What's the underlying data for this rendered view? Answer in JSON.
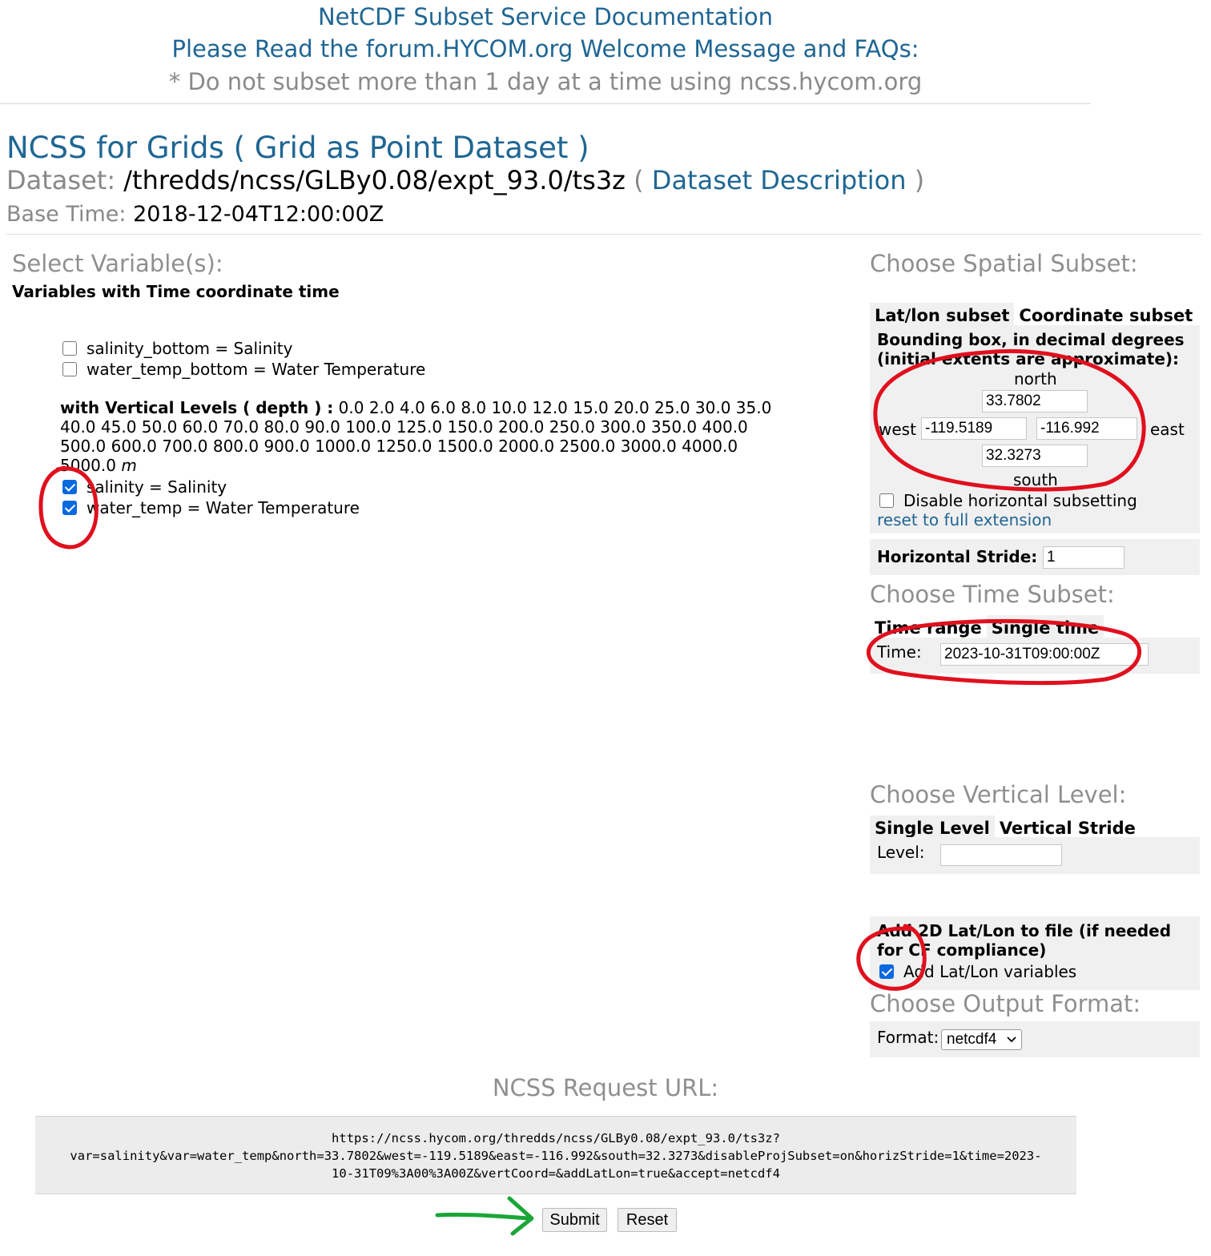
{
  "banner": {
    "doc_link": "NetCDF Subset Service Documentation",
    "forum_link": "Please Read the forum.HYCOM.org Welcome Message and FAQs:",
    "note": "* Do not subset more than 1 day at a time using ncss.hycom.org"
  },
  "header": {
    "title": "NCSS for Grids",
    "title_paren_open": "(",
    "title_link": "Grid as Point Dataset",
    "title_paren_close": ")",
    "dataset_label": "Dataset:",
    "dataset_value": "/thredds/ncss/GLBy0.08/expt_93.0/ts3z",
    "dataset_paren_open": "(",
    "dataset_link": "Dataset Description",
    "dataset_paren_close": ")",
    "base_time_label": "Base Time:",
    "base_time_value": "2018-12-04T12:00:00Z"
  },
  "variables": {
    "heading": "Select Variable(s):",
    "group_title": "Variables with Time coordinate time",
    "time_vars": [
      {
        "label": "salinity_bottom = Salinity",
        "checked": false
      },
      {
        "label": "water_temp_bottom = Water Temperature",
        "checked": false
      }
    ],
    "vertical_title": "with Vertical Levels ( depth ) :",
    "vertical_levels": "0.0 2.0 4.0 6.0 8.0 10.0 12.0 15.0 20.0 25.0 30.0 35.0 40.0 45.0 50.0 60.0 70.0 80.0 90.0 100.0 125.0 150.0 200.0 250.0 300.0 350.0 400.0 500.0 600.0 700.0 800.0 900.0 1000.0 1250.0 1500.0 2000.0 2500.0 3000.0 4000.0 5000.0",
    "vertical_unit": "m",
    "depth_vars": [
      {
        "label": "salinity = Salinity",
        "checked": true
      },
      {
        "label": "water_temp = Water Temperature",
        "checked": true
      }
    ]
  },
  "spatial": {
    "heading": "Choose Spatial Subset:",
    "tab_latlon": "Lat/lon subset",
    "tab_coord": "Coordinate subset",
    "bbox_title_line1": "Bounding box, in decimal degrees",
    "bbox_title_line2": "(initial extents are approximate):",
    "north_label": "north",
    "north": "33.7802",
    "west_label": "west",
    "west": "-119.5189",
    "east": "-116.992",
    "east_label": "east",
    "south": "32.3273",
    "south_label": "south",
    "disable_label": "Disable horizontal subsetting",
    "disable_checked": false,
    "reset_link": "reset to full extension",
    "stride_label": "Horizontal Stride:",
    "stride": "1"
  },
  "time": {
    "heading": "Choose Time Subset:",
    "tab_range": "Time range",
    "tab_single": "Single time",
    "time_label": "Time:",
    "time_value": "2023-10-31T09:00:00Z"
  },
  "vertical": {
    "heading": "Choose Vertical Level:",
    "tab_single": "Single Level",
    "tab_stride": "Vertical Stride",
    "level_label": "Level:",
    "level_value": ""
  },
  "latlon": {
    "title_line1": "Add 2D Lat/Lon to file (if needed",
    "title_line2": "for CF compliance)",
    "checkbox_label": "Add Lat/Lon variables",
    "checked": true
  },
  "output": {
    "heading": "Choose Output Format:",
    "format_label": "Format:",
    "format_value": "netcdf4"
  },
  "request": {
    "heading": "NCSS Request URL:",
    "url_line1": "https://ncss.hycom.org/thredds/ncss/GLBy0.08/expt_93.0/ts3z?",
    "url_line2": "var=salinity&var=water_temp&north=33.7802&west=-119.5189&east=-116.992&south=32.3273&disableProjSubset=on&horizStride=1&time=2023-",
    "url_line3": "10-31T09%3A00%3A00Z&vertCoord=&addLatLon=true&accept=netcdf4"
  },
  "buttons": {
    "submit": "Submit",
    "reset": "Reset"
  },
  "colors": {
    "link": "#1f6693",
    "muted_heading": "#8f8f8f",
    "panel_bg": "#f0f0f0",
    "checkbox_checked": "#0b69e0",
    "annotation_red": "#e0101e",
    "annotation_green": "#1aa637"
  }
}
